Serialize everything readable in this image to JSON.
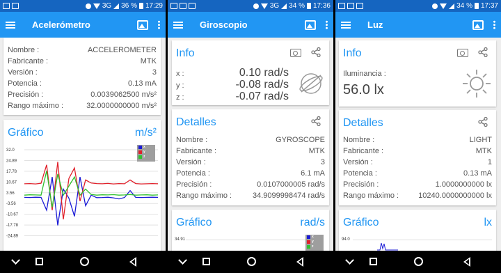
{
  "status": {
    "battery_a": "36 %",
    "time_a": "17:29",
    "battery_b": "34 %",
    "time_b": "17:36",
    "battery_c": "34 %",
    "time_c": "17:37",
    "network": "3G"
  },
  "screens": {
    "accel": {
      "title": "Acelerómetro",
      "details_rows": [
        {
          "label": "Nombre :",
          "value": "ACCELEROMETER"
        },
        {
          "label": "Fabricante :",
          "value": "MTK"
        },
        {
          "label": "Versión :",
          "value": "3"
        },
        {
          "label": "Potencia :",
          "value": "0.13 mA"
        },
        {
          "label": "Precisión :",
          "value": "0.0039062500 m/s²"
        },
        {
          "label": "Rango máximo :",
          "value": "32.0000000000 m/s²"
        }
      ],
      "graph_title": "Gráfico",
      "graph_unit": "m/s²",
      "legend": [
        "x",
        "y",
        "z"
      ]
    },
    "gyro": {
      "title": "Giroscopio",
      "info_title": "Info",
      "info_rows": [
        {
          "label": "x :",
          "value": "0.10 rad/s"
        },
        {
          "label": "y :",
          "value": "-0.08 rad/s"
        },
        {
          "label": "z :",
          "value": "-0.07 rad/s"
        }
      ],
      "details_title": "Detalles",
      "details_rows": [
        {
          "label": "Nombre :",
          "value": "GYROSCOPE"
        },
        {
          "label": "Fabricante :",
          "value": "MTK"
        },
        {
          "label": "Versión :",
          "value": "3"
        },
        {
          "label": "Potencia :",
          "value": "6.1 mA"
        },
        {
          "label": "Precisión :",
          "value": "0.0107000005 rad/s"
        },
        {
          "label": "Rango máximo :",
          "value": "34.9099998474 rad/s"
        }
      ],
      "graph_title": "Gráfico",
      "graph_unit": "rad/s",
      "graph_top_tick": "34.91",
      "legend": [
        "x",
        "y",
        "z"
      ]
    },
    "light": {
      "title": "Luz",
      "info_title": "Info",
      "info_label": "Iluminancia :",
      "info_value": "56.0 lx",
      "details_title": "Detalles",
      "details_rows": [
        {
          "label": "Nombre :",
          "value": "LIGHT"
        },
        {
          "label": "Fabricante :",
          "value": "MTK"
        },
        {
          "label": "Versión :",
          "value": "1"
        },
        {
          "label": "Potencia :",
          "value": "0.13 mA"
        },
        {
          "label": "Precisión :",
          "value": "1.0000000000 lx"
        },
        {
          "label": "Rango máximo :",
          "value": "10240.0000000000 lx"
        }
      ],
      "graph_title": "Gráfico",
      "graph_unit": "lx",
      "graph_top_tick": "94.0"
    }
  },
  "colors": {
    "appbar": "#2196f3",
    "statusbar": "#1565c0",
    "accent": "#2196f3",
    "series_x": "#1a1ad6",
    "series_y": "#e0202a",
    "series_z": "#30c030"
  },
  "chart_data": [
    {
      "type": "line",
      "title": "Gráfico",
      "ylabel": "m/s²",
      "yticks": [
        "32.0",
        "24.89",
        "17.78",
        "10.67",
        "3.56",
        "-3.56",
        "-10.67",
        "-17.78",
        "-24.89"
      ],
      "ylim": [
        -32,
        32
      ],
      "series": [
        {
          "name": "x",
          "values": [
            0.5,
            0.4,
            0.6,
            0.5,
            -8,
            14,
            -18,
            6,
            0,
            -12,
            14,
            -5,
            2,
            0.3,
            0.4,
            0.6,
            0.2,
            -0.5,
            0.4,
            5,
            0.5,
            0.4,
            0.5,
            0.6,
            0.5
          ]
        },
        {
          "name": "y",
          "values": [
            9.5,
            9.6,
            9.4,
            9.8,
            22,
            -8,
            24,
            -14,
            13,
            20,
            -2,
            12,
            10,
            9.6,
            9.5,
            9.7,
            9.4,
            9.6,
            9.5,
            12,
            9.6,
            9.4,
            9.5,
            9.6,
            9.5
          ]
        },
        {
          "name": "z",
          "values": [
            2,
            2.2,
            2.1,
            2,
            18,
            -6,
            16,
            2,
            8,
            14,
            2,
            6,
            2.4,
            2,
            2.2,
            2.1,
            2.3,
            2,
            2.1,
            2.4,
            2,
            2.1,
            2.2,
            2,
            2.1
          ]
        }
      ],
      "legend_position": "top-right",
      "grid": true
    }
  ]
}
